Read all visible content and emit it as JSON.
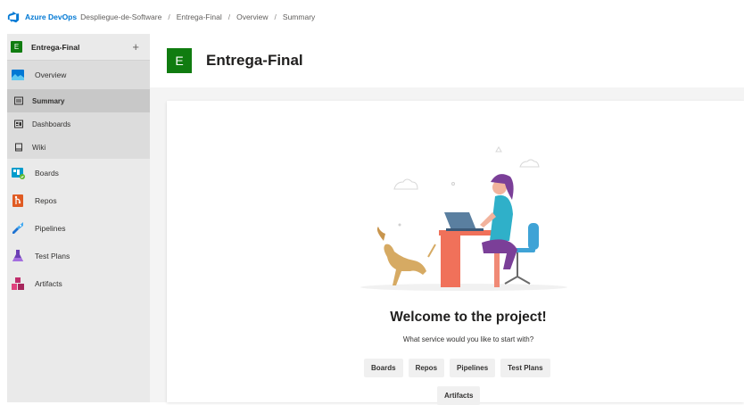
{
  "topbar": {
    "brand": "Azure DevOps",
    "breadcrumbs": [
      "Despliegue-de-Software",
      "Entrega-Final",
      "Overview",
      "Summary"
    ]
  },
  "sidebar": {
    "project_initial": "E",
    "project_name": "Entrega-Final",
    "add_symbol": "+",
    "overview_label": "Overview",
    "sub_items": [
      {
        "label": "Summary",
        "icon": "summary-icon",
        "active": true
      },
      {
        "label": "Dashboards",
        "icon": "dashboard-icon",
        "active": false
      },
      {
        "label": "Wiki",
        "icon": "wiki-icon",
        "active": false
      }
    ],
    "items": [
      {
        "label": "Boards",
        "icon": "boards-icon"
      },
      {
        "label": "Repos",
        "icon": "repos-icon"
      },
      {
        "label": "Pipelines",
        "icon": "pipelines-icon"
      },
      {
        "label": "Test Plans",
        "icon": "test-plans-icon"
      },
      {
        "label": "Artifacts",
        "icon": "artifacts-icon"
      }
    ]
  },
  "header": {
    "project_initial": "E",
    "title": "Entrega-Final"
  },
  "welcome": {
    "title": "Welcome to the project!",
    "question": "What service would you like to start with?",
    "services": [
      "Boards",
      "Repos",
      "Pipelines",
      "Test Plans",
      "Artifacts"
    ]
  },
  "colors": {
    "project_green": "#107c10",
    "brand_blue": "#0078d4"
  }
}
